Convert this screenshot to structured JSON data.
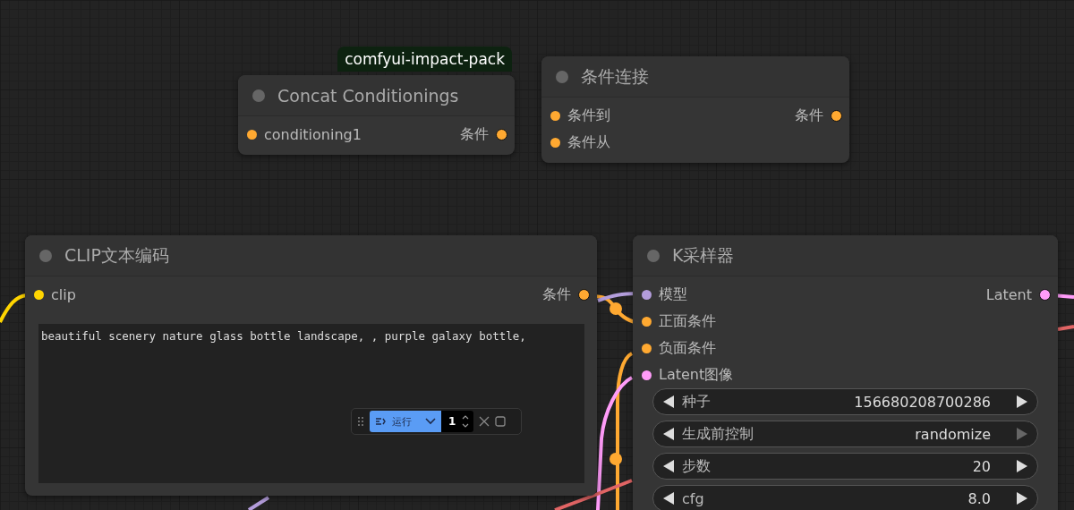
{
  "nodes": [
    {
      "kind": "node",
      "title": "Concat Conditionings",
      "badge": "comfyui-impact-pack",
      "inputs": [
        {
          "label": "conditioning1",
          "color": "#ffa931"
        }
      ],
      "outputs": [
        {
          "label": "条件",
          "color": "#ffa931"
        }
      ]
    },
    {
      "kind": "node",
      "title": "条件连接",
      "inputs": [
        {
          "label": "条件到",
          "color": "#ffa931"
        },
        {
          "label": "条件从",
          "color": "#ffa931"
        }
      ],
      "outputs": [
        {
          "label": "条件",
          "color": "#ffa931"
        }
      ]
    },
    {
      "kind": "node",
      "title": "CLIP文本编码",
      "inputs": [
        {
          "label": "clip",
          "color": "#ffd500"
        }
      ],
      "outputs": [
        {
          "label": "条件",
          "color": "#ffa931"
        }
      ],
      "text": "beautiful scenery nature glass bottle landscape, , purple galaxy bottle,"
    },
    {
      "kind": "node",
      "title": "K采样器",
      "inputs": [
        {
          "label": "模型",
          "color": "#b39ddb"
        },
        {
          "label": "正面条件",
          "color": "#ffa931"
        },
        {
          "label": "负面条件",
          "color": "#ffa931"
        },
        {
          "label": "Latent图像",
          "color": "#ff9cf9"
        }
      ],
      "outputs": [
        {
          "label": "Latent",
          "color": "#ff9cf9"
        }
      ],
      "widgets": [
        {
          "label": "种子",
          "value": "156680208700286",
          "next_enabled": true
        },
        {
          "label": "生成前控制",
          "value": "randomize",
          "next_enabled": false
        },
        {
          "label": "步数",
          "value": "20",
          "next_enabled": true
        },
        {
          "label": "cfg",
          "value": "8.0",
          "next_enabled": true
        }
      ]
    }
  ],
  "run_toolbar": {
    "button": "运行",
    "count": "1"
  }
}
